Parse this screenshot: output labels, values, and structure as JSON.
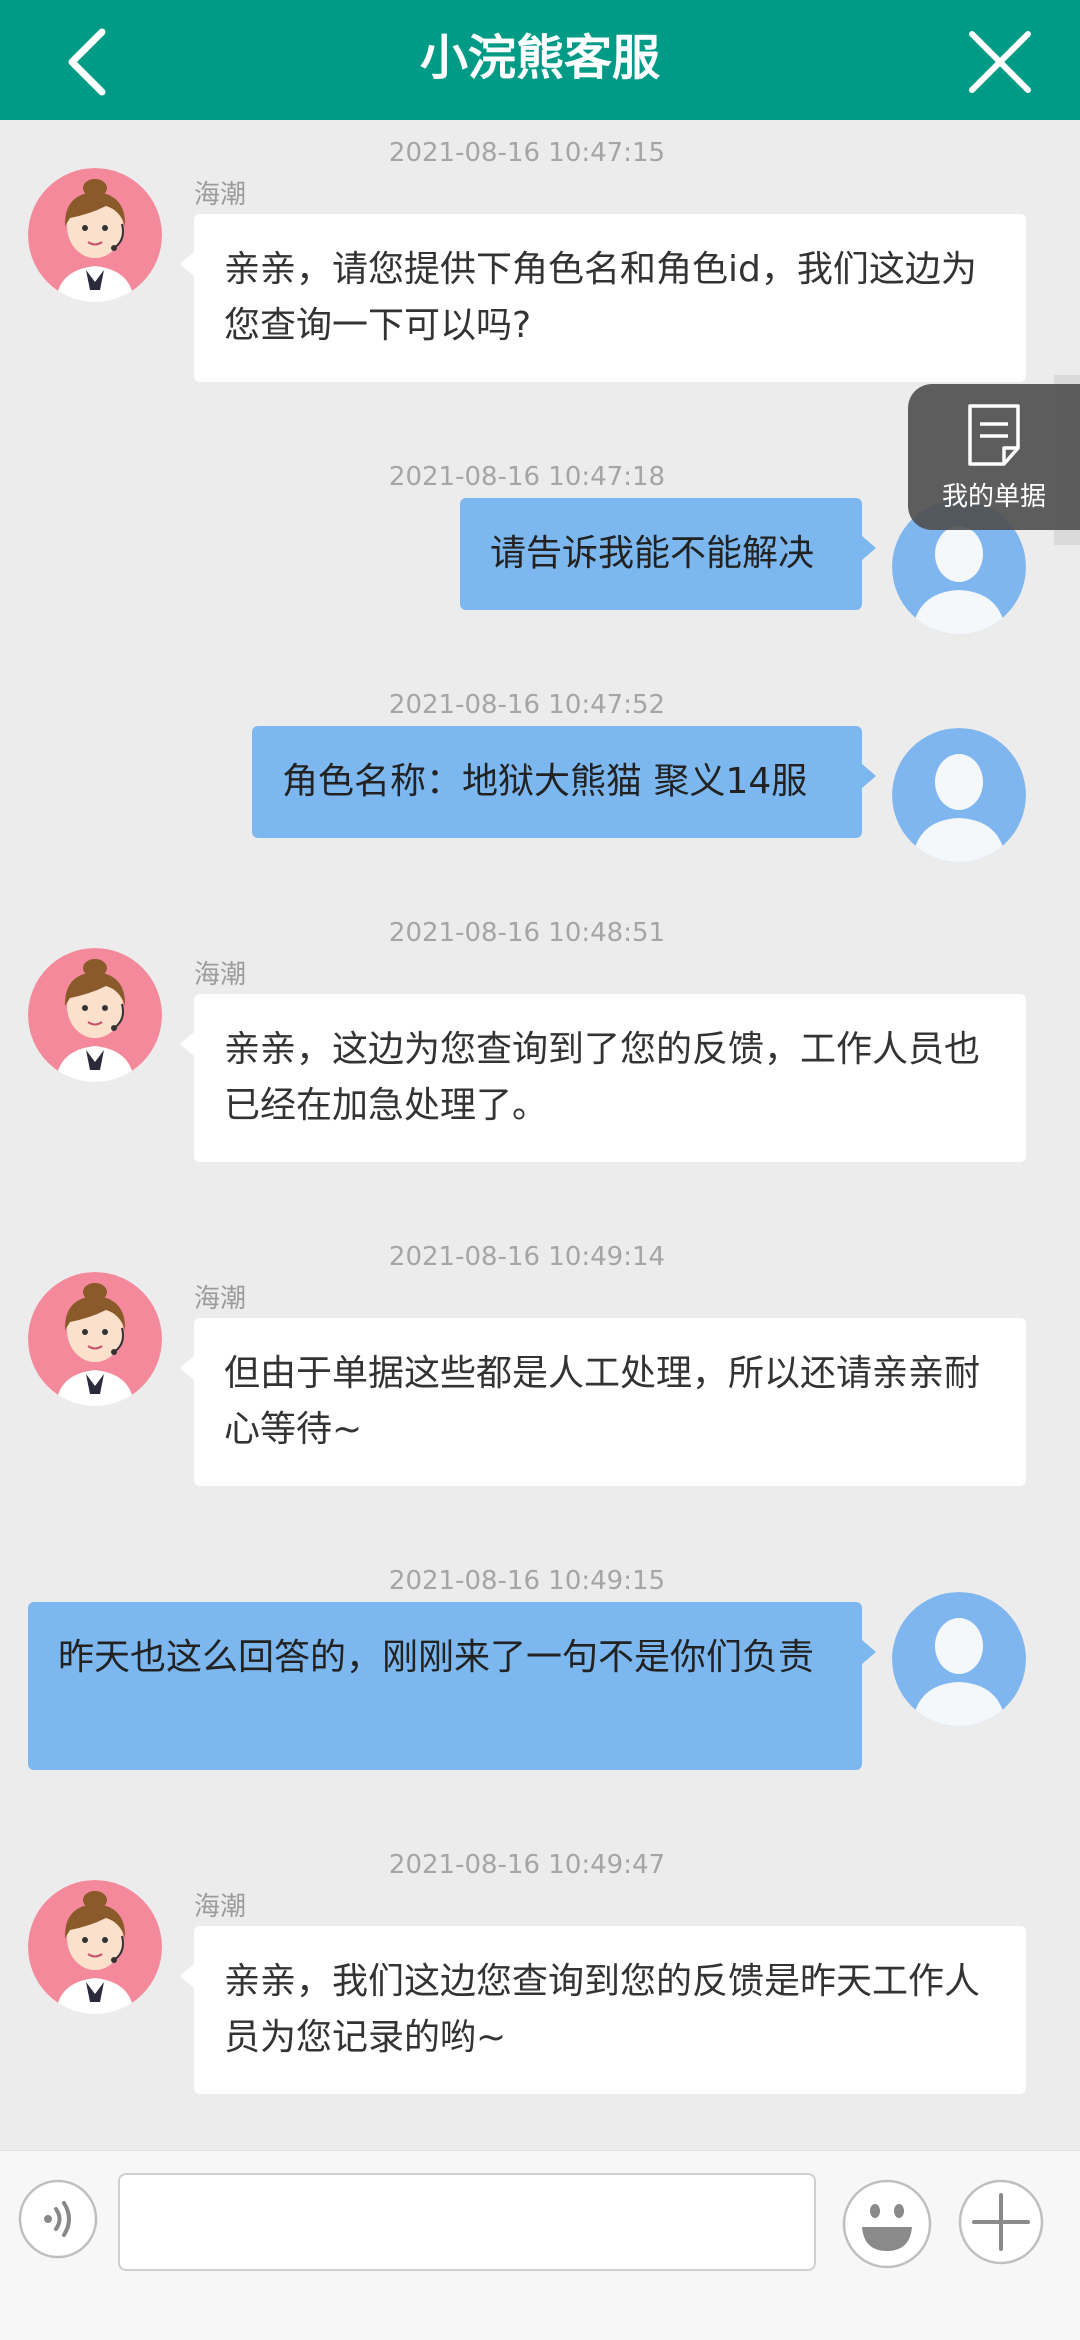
{
  "header": {
    "title": "小浣熊客服",
    "back_icon": "chevron-left-icon",
    "close_icon": "close-icon"
  },
  "floating": {
    "label": "我的单据",
    "icon": "document-icon"
  },
  "messages": [
    {
      "time": "2021-08-16 10:47:15",
      "from": "agent",
      "name": "海潮",
      "text": "亲亲，请您提供下角色名和角色id，我们这边为您查询一下可以吗?"
    },
    {
      "time": "2021-08-16 10:47:18",
      "from": "user",
      "text": "请告诉我能不能解决"
    },
    {
      "time": "2021-08-16 10:47:52",
      "from": "user",
      "text": "角色名称：地狱大熊猫 聚义14服"
    },
    {
      "time": "2021-08-16 10:48:51",
      "from": "agent",
      "name": "海潮",
      "text": "亲亲，这边为您查询到了您的反馈，工作人员也已经在加急处理了。"
    },
    {
      "time": "2021-08-16 10:49:14",
      "from": "agent",
      "name": "海潮",
      "text": "但由于单据这些都是人工处理，所以还请亲亲耐心等待~"
    },
    {
      "time": "2021-08-16 10:49:15",
      "from": "user",
      "text": "昨天也这么回答的，刚刚来了一句不是你们负责"
    },
    {
      "time": "2021-08-16 10:49:47",
      "from": "agent",
      "name": "海潮",
      "text": "亲亲，我们这边您查询到您的反馈是昨天工作人员为您记录的哟~"
    }
  ],
  "composer": {
    "input_value": "",
    "voice_icon": "voice-icon",
    "emoji_icon": "emoji-icon",
    "plus_icon": "plus-icon"
  },
  "colors": {
    "header": "#009b86",
    "user_bubble": "#7cb8ef",
    "agent_bubble": "#ffffff",
    "background": "#ececec"
  }
}
